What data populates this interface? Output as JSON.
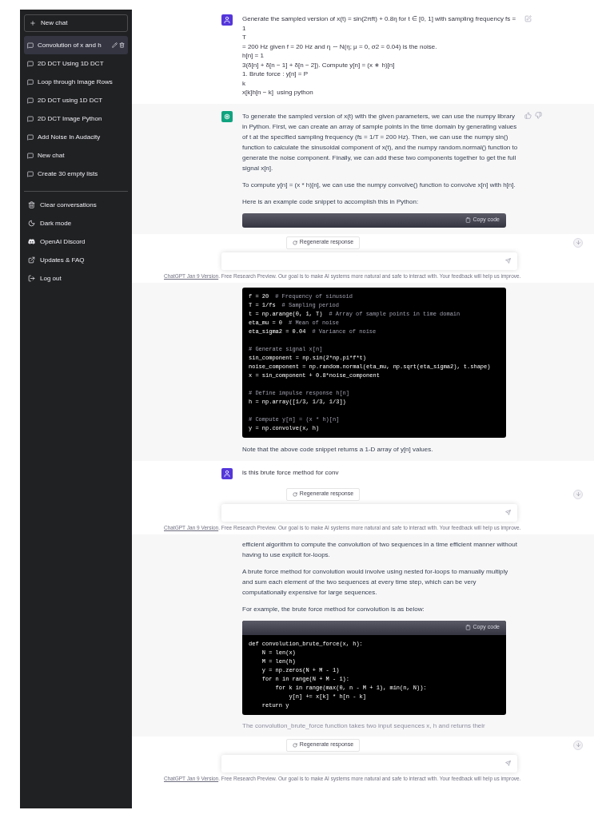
{
  "sidebar": {
    "new_chat": "New chat",
    "conversations": [
      {
        "title": "Convolution of x and h",
        "selected": true
      },
      {
        "title": "2D DCT Using 1D DCT",
        "selected": false
      },
      {
        "title": "Loop through Image Rows",
        "selected": false
      },
      {
        "title": "2D DCT using 1D DCT",
        "selected": false
      },
      {
        "title": "2D DCT Image Python",
        "selected": false
      },
      {
        "title": "Add Noise In Audacity",
        "selected": false
      },
      {
        "title": "New chat",
        "selected": false
      },
      {
        "title": "Create 30 empty lists",
        "selected": false
      }
    ],
    "menu": [
      {
        "label": "Clear conversations",
        "kind": "trash"
      },
      {
        "label": "Dark mode",
        "kind": "moon"
      },
      {
        "label": "OpenAI Discord",
        "kind": "discord"
      },
      {
        "label": "Updates & FAQ",
        "kind": "external"
      },
      {
        "label": "Log out",
        "kind": "logout"
      }
    ]
  },
  "panels": [
    {
      "sections": [
        {
          "kind": "user",
          "avatar_visible": true,
          "actions": [
            {
              "kind": "edit"
            }
          ],
          "blocks": [
            {
              "kind": "lines",
              "lines": [
                "Generate the sampled version of x(t) = sin(2πft) + 0.8η for t ∈ [0, 1] with sampling frequency fs = 1",
                "T",
                "= 200 Hz given f = 20 Hz and η ∼ N(η; μ = 0, σ2 = 0.04) is the noise.",
                "h[n] = 1",
                "3(δ[n] + δ[n − 1] + δ[n − 2]). Compute y[n] = (x ∗ h)[n]",
                "1. Brute force : y[n] = P",
                "k",
                "x[k]h[n − k]  using python"
              ]
            }
          ]
        },
        {
          "kind": "assistant",
          "avatar_visible": true,
          "actions": [
            {
              "kind": "thumbs-up"
            },
            {
              "kind": "thumbs-down"
            }
          ],
          "blocks": [
            {
              "kind": "paragraph",
              "text": "To generate the sampled version of x(t) with the given parameters, we can use the numpy library in Python. First, we can create an array of sample points in the time domain by generating values of t at the specified sampling frequency (fs = 1/T = 200 Hz). Then, we can use the numpy sin() function to calculate the sinusoidal component of x(t), and the numpy random.normal() function to generate the noise component. Finally, we can add these two components together to get the full signal x[n]."
            },
            {
              "kind": "paragraph",
              "text": "To compute y[n] = (x * h)[n], we can use the numpy convolve() function to convolve x[n] with h[n]."
            },
            {
              "kind": "paragraph",
              "text": "Here is an example code snippet to accomplish this in Python:"
            },
            {
              "kind": "code",
              "copy_label": "Copy code"
            }
          ]
        }
      ],
      "regenerate": "Regenerate response",
      "footer": {
        "link": "ChatGPT Jan 9 Version",
        "text": ". Free Research Preview. Our goal is to make AI systems more natural and safe to interact with. Your feedback will help us improve."
      }
    },
    {
      "sections": [
        {
          "kind": "assistant",
          "avatar_visible": false,
          "blocks": [
            {
              "kind": "code",
              "groups": [
                [
                  {
                    "code": "f = 20",
                    "comment": "# Frequency of sinusoid"
                  },
                  {
                    "code": "T = 1/fs",
                    "comment": "# Sampling period"
                  },
                  {
                    "code": "t = np.arange(0, 1, T)",
                    "comment": "# Array of sample points in time domain"
                  },
                  {
                    "code": "eta_mu = 0",
                    "comment": "# Mean of noise"
                  },
                  {
                    "code": "eta_sigma2 = 0.04",
                    "comment": "# Variance of noise"
                  }
                ],
                [
                  {
                    "comment": "# Generate signal x[n]"
                  },
                  {
                    "code": "sin_component = np.sin(2*np.pi*f*t)"
                  },
                  {
                    "code": "noise_component = np.random.normal(eta_mu, np.sqrt(eta_sigma2), t.shape)"
                  },
                  {
                    "code": "x = sin_component + 0.8*noise_component"
                  }
                ],
                [
                  {
                    "comment": "# Define impulse response h[n]"
                  },
                  {
                    "code": "h = np.array([1/3, 1/3, 1/3])"
                  }
                ],
                [
                  {
                    "comment": "# Compute y[n] = (x * h)[n]"
                  },
                  {
                    "code": "y = np.convolve(x, h)"
                  }
                ]
              ]
            },
            {
              "kind": "paragraph",
              "text": "Note that the above code snippet returns a 1-D array of y[n] values."
            }
          ]
        },
        {
          "kind": "user",
          "avatar_visible": true,
          "blocks": [
            {
              "kind": "lines",
              "lines": [
                "is this brute force method for conv"
              ]
            }
          ]
        }
      ],
      "regenerate": "Regenerate response",
      "footer": {
        "link": "ChatGPT Jan 9 Version",
        "text": ". Free Research Preview. Our goal is to make AI systems more natural and safe to interact with. Your feedback will help us improve."
      }
    },
    {
      "sections": [
        {
          "kind": "assistant",
          "avatar_visible": false,
          "blocks": [
            {
              "kind": "paragraph",
              "text": "efficient algorithm to compute the convolution of two sequences in a time efficient manner without having to use explicit for-loops."
            },
            {
              "kind": "paragraph",
              "text": "A brute force method for convolution would involve using nested for-loops to manually multiply and sum each element of the two sequences at every time step, which can be very computationally expensive for large sequences."
            },
            {
              "kind": "paragraph",
              "text": "For example, the brute force method for convolution is as below:"
            },
            {
              "kind": "code",
              "copy_label": "Copy code",
              "groups": [
                [
                  {
                    "code": "def convolution_brute_force(x, h):"
                  },
                  {
                    "code": "    N = len(x)"
                  },
                  {
                    "code": "    M = len(h)"
                  },
                  {
                    "code": "    y = np.zeros(N + M - 1)"
                  },
                  {
                    "code": "    for n in range(N + M - 1):"
                  },
                  {
                    "code": "        for k in range(max(0, n - M + 1), min(n, N)):"
                  },
                  {
                    "code": "            y[n] += x[k] * h[n - k]"
                  },
                  {
                    "code": "    return y"
                  }
                ]
              ]
            },
            {
              "kind": "faded",
              "text": "The convolution_brute_force function takes two input sequences x, h and returns their"
            }
          ]
        }
      ],
      "regenerate": "Regenerate response",
      "footer": {
        "link": "ChatGPT Jan 9 Version",
        "text": ". Free Research Preview. Our goal is to make AI systems more natural and safe to interact with. Your feedback will help us improve."
      }
    }
  ]
}
